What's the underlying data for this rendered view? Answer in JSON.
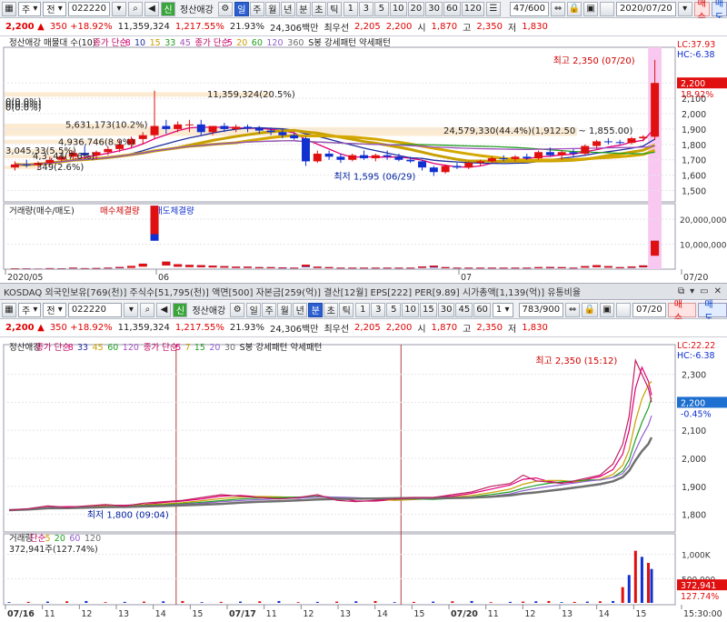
{
  "top": {
    "toolbar": {
      "code": "022220",
      "type1": "주",
      "type2": "전",
      "name": "정산애강",
      "periods": [
        "일",
        "주",
        "월",
        "년",
        "분",
        "초",
        "틱"
      ],
      "active_period": 0,
      "numbers": [
        "1",
        "3",
        "5",
        "10",
        "20",
        "30",
        "60",
        "120"
      ],
      "counter": "47",
      "counter_total": "/600",
      "date": "2020/07/20",
      "buy": "매수",
      "sell": "매도"
    },
    "quote": {
      "price": "2,200 ▲",
      "change": "350 +18.92%",
      "volume": "11,359,324",
      "rate": "1,217.55%",
      "turnover": "21.93%",
      "amount": "24,306백만",
      "best_label": "최우선",
      "ask": "2,205",
      "bid": "2,200",
      "open_label": "시",
      "open": "1,870",
      "high_label": "고",
      "high": "2,350",
      "low_label": "저",
      "low": "1,830"
    }
  },
  "status_bar": "KOSDAQ 외국인보유[769(천)] 주식수[51,795(천)] 액면[500] 자본금[259(억)] 결산[12월] EPS[222] PER[9.89] 시가총액[1,139(억)] 유통비율",
  "bottom": {
    "toolbar": {
      "code": "022220",
      "type1": "주",
      "type2": "전",
      "name": "정산애강",
      "periods": [
        "일",
        "주",
        "월",
        "년",
        "분",
        "초",
        "틱"
      ],
      "active_period": 4,
      "numbers": [
        "1",
        "3",
        "5",
        "10",
        "15",
        "30",
        "45",
        "60"
      ],
      "interval": "1",
      "counter": "783",
      "counter_total": "/900",
      "date": "07/20",
      "buy": "매수",
      "sell": "매도"
    },
    "quote": {
      "price": "2,200 ▲",
      "change": "350 +18.92%",
      "volume": "11,359,324",
      "rate": "1,217.55%",
      "turnover": "21.93%",
      "amount": "24,306백만",
      "best_label": "최우선",
      "ask": "2,205",
      "bid": "2,200",
      "open_label": "시",
      "open": "1,870",
      "high_label": "고",
      "high": "2,350",
      "low_label": "저",
      "low": "1,830"
    }
  },
  "chart_data": [
    {
      "type": "candlestick",
      "title": "정산애강 매물대 수(10)",
      "ma_label": "종가 단순",
      "ma_periods": [
        "8",
        "10",
        "15",
        "33",
        "45"
      ],
      "ma2_periods": [
        "5",
        "20",
        "60",
        "120",
        "360"
      ],
      "ma_colors": [
        "#e0007a",
        "#2030a0",
        "#c8a000",
        "#20a020",
        "#a050c0"
      ],
      "ma2_colors": [
        "#e0007a",
        "#c8a000",
        "#20a020",
        "#9060d0",
        "#707070"
      ],
      "extra_label": "S봉 강세패턴  약세패턴",
      "lc": "LC:37.93",
      "hc": "HC:-6.38",
      "yticks": [
        1500,
        1600,
        1700,
        1800,
        1900,
        2000,
        2100,
        2200
      ],
      "ytick_labels": [
        "1,500",
        "1,600",
        "1,700",
        "1,800",
        "1,900",
        "2,000",
        "2,100",
        "2,200"
      ],
      "ylim": [
        1450,
        2420
      ],
      "current_price": "2,200",
      "current_pct": "18.92%",
      "high_annotation": "최고 2,350 (07/20)",
      "low_annotation": "최저 1,595 (06/29)",
      "volume_profile": [
        {
          "label": "11,359,324(20.5%)"
        },
        {
          "label": "0(0.0%)"
        },
        {
          "label": "0(0.0%)"
        },
        {
          "label": "0(0.0%)"
        },
        {
          "label": "5,631,173(10.2%)"
        },
        {
          "label": "24,579,330(44.4%)(1,912.50 ~ 1,855.00)"
        },
        {
          "label": "4,936,746(8.9%)"
        },
        {
          "label": "3,045,33(5.5%)"
        },
        {
          "label": "4,3 ,44(7.6%)"
        },
        {
          "label": "349(2.6%)"
        }
      ],
      "xlabels": [
        "2020/05",
        "06",
        "07",
        "07/20"
      ],
      "candles": [
        [
          1650,
          1690,
          1630,
          1670
        ],
        [
          1670,
          1700,
          1650,
          1665
        ],
        [
          1665,
          1690,
          1640,
          1680
        ],
        [
          1680,
          1720,
          1660,
          1700
        ],
        [
          1700,
          1730,
          1690,
          1720
        ],
        [
          1720,
          1760,
          1700,
          1745
        ],
        [
          1745,
          1790,
          1720,
          1730
        ],
        [
          1730,
          1760,
          1700,
          1750
        ],
        [
          1750,
          1790,
          1730,
          1770
        ],
        [
          1770,
          1830,
          1750,
          1800
        ],
        [
          1800,
          1850,
          1780,
          1835
        ],
        [
          1835,
          1880,
          1800,
          1860
        ],
        [
          1860,
          2150,
          1840,
          1920
        ],
        [
          1920,
          1960,
          1870,
          1900
        ],
        [
          1900,
          1950,
          1880,
          1930
        ],
        [
          1930,
          1960,
          1880,
          1930
        ],
        [
          1930,
          1960,
          1860,
          1880
        ],
        [
          1880,
          1920,
          1860,
          1920
        ],
        [
          1920,
          1940,
          1880,
          1900
        ],
        [
          1900,
          1930,
          1880,
          1915
        ],
        [
          1915,
          1930,
          1880,
          1905
        ],
        [
          1905,
          1920,
          1870,
          1890
        ],
        [
          1890,
          1910,
          1860,
          1880
        ],
        [
          1880,
          1900,
          1840,
          1860
        ],
        [
          1860,
          1880,
          1830,
          1840
        ],
        [
          1840,
          1850,
          1660,
          1690
        ],
        [
          1690,
          1760,
          1680,
          1740
        ],
        [
          1740,
          1760,
          1700,
          1720
        ],
        [
          1720,
          1740,
          1680,
          1700
        ],
        [
          1700,
          1740,
          1690,
          1730
        ],
        [
          1730,
          1760,
          1700,
          1710
        ],
        [
          1710,
          1740,
          1690,
          1730
        ],
        [
          1730,
          1760,
          1700,
          1720
        ],
        [
          1720,
          1740,
          1690,
          1700
        ],
        [
          1700,
          1720,
          1680,
          1690
        ],
        [
          1690,
          1700,
          1630,
          1650
        ],
        [
          1650,
          1660,
          1595,
          1620
        ],
        [
          1620,
          1670,
          1610,
          1660
        ],
        [
          1660,
          1680,
          1640,
          1650
        ],
        [
          1650,
          1690,
          1640,
          1680
        ],
        [
          1680,
          1700,
          1660,
          1690
        ],
        [
          1690,
          1720,
          1680,
          1710
        ],
        [
          1710,
          1730,
          1690,
          1705
        ],
        [
          1705,
          1730,
          1690,
          1720
        ],
        [
          1720,
          1740,
          1700,
          1710
        ],
        [
          1710,
          1760,
          1700,
          1750
        ],
        [
          1750,
          1780,
          1720,
          1730
        ],
        [
          1730,
          1760,
          1700,
          1750
        ],
        [
          1750,
          1770,
          1720,
          1740
        ],
        [
          1740,
          1800,
          1730,
          1790
        ],
        [
          1790,
          1830,
          1770,
          1820
        ],
        [
          1820,
          1840,
          1800,
          1815
        ],
        [
          1815,
          1830,
          1800,
          1810
        ],
        [
          1810,
          1850,
          1800,
          1840
        ],
        [
          1840,
          1860,
          1820,
          1850
        ],
        [
          1850,
          2350,
          1830,
          2200
        ]
      ],
      "volume_ylim": [
        0,
        24000000
      ],
      "volume_yticks": [
        "20,000,000",
        "10,000,000"
      ],
      "volume_title": "거래량(매수/매도)",
      "volume_legend_buy": "매수체결량",
      "volume_legend_sell": "매도체결량",
      "volumes": [
        [
          200000,
          150000
        ],
        [
          150000,
          120000
        ],
        [
          100000,
          100000
        ],
        [
          200000,
          200000
        ],
        [
          150000,
          150000
        ],
        [
          300000,
          300000
        ],
        [
          200000,
          200000
        ],
        [
          250000,
          200000
        ],
        [
          300000,
          300000
        ],
        [
          400000,
          500000
        ],
        [
          800000,
          500000
        ],
        [
          1200000,
          1000000
        ],
        [
          11359324,
          14000000
        ],
        [
          1500000,
          1500000
        ],
        [
          1000000,
          1000000
        ],
        [
          900000,
          800000
        ],
        [
          800000,
          800000
        ],
        [
          700000,
          700000
        ],
        [
          600000,
          600000
        ],
        [
          500000,
          500000
        ],
        [
          500000,
          500000
        ],
        [
          400000,
          400000
        ],
        [
          400000,
          400000
        ],
        [
          300000,
          400000
        ],
        [
          300000,
          300000
        ],
        [
          800000,
          1000000
        ],
        [
          500000,
          500000
        ],
        [
          400000,
          400000
        ],
        [
          300000,
          300000
        ],
        [
          300000,
          300000
        ],
        [
          300000,
          300000
        ],
        [
          300000,
          300000
        ],
        [
          300000,
          300000
        ],
        [
          300000,
          300000
        ],
        [
          300000,
          300000
        ],
        [
          500000,
          600000
        ],
        [
          600000,
          800000
        ],
        [
          400000,
          400000
        ],
        [
          300000,
          300000
        ],
        [
          300000,
          300000
        ],
        [
          300000,
          300000
        ],
        [
          300000,
          300000
        ],
        [
          300000,
          300000
        ],
        [
          300000,
          300000
        ],
        [
          300000,
          300000
        ],
        [
          400000,
          400000
        ],
        [
          400000,
          500000
        ],
        [
          400000,
          400000
        ],
        [
          300000,
          300000
        ],
        [
          600000,
          600000
        ],
        [
          800000,
          800000
        ],
        [
          600000,
          600000
        ],
        [
          400000,
          400000
        ],
        [
          500000,
          600000
        ],
        [
          700000,
          800000
        ],
        [
          6000000,
          5359324
        ]
      ]
    },
    {
      "type": "line",
      "title": "정산애강",
      "ma_label": "종가 단순",
      "ma_periods": [
        "8",
        "33",
        "45",
        "60",
        "120"
      ],
      "ma2_periods": [
        "5",
        "7",
        "15",
        "20",
        "30"
      ],
      "ma_colors": [
        "#e0007a",
        "#2030a0",
        "#c8a000",
        "#20a020",
        "#a050c0"
      ],
      "ma2_colors": [
        "#e0007a",
        "#c8a000",
        "#20a020",
        "#9060d0",
        "#707070"
      ],
      "extra_label": "S봉 강세패턴  약세패턴",
      "lc": "LC:22.22",
      "hc": "HC:-6.38",
      "yticks": [
        1800,
        1900,
        2000,
        2100,
        2200,
        2300
      ],
      "ytick_labels": [
        "1,800",
        "1,900",
        "2,000",
        "2,100",
        "2,200",
        "2,300"
      ],
      "ylim": [
        1750,
        2380
      ],
      "current_price": "2,200",
      "current_pct": "-0.45%",
      "high_annotation": "최고 2,350 (15:12)",
      "low_annotation": "최저 1,800 (09:04)",
      "x": [
        0,
        0.03,
        0.06,
        0.09,
        0.12,
        0.15,
        0.18,
        0.21,
        0.24,
        0.27,
        0.3,
        0.33,
        0.36,
        0.39,
        0.42,
        0.45,
        0.48,
        0.51,
        0.54,
        0.57,
        0.6,
        0.63,
        0.66,
        0.69,
        0.72,
        0.75,
        0.78,
        0.8,
        0.82,
        0.84,
        0.86,
        0.88,
        0.9,
        0.92,
        0.94,
        0.955,
        0.965,
        0.975,
        0.985,
        0.995,
        1.0
      ],
      "price": [
        1815,
        1820,
        1830,
        1825,
        1830,
        1835,
        1830,
        1840,
        1845,
        1850,
        1860,
        1870,
        1865,
        1860,
        1855,
        1860,
        1870,
        1850,
        1845,
        1850,
        1855,
        1860,
        1860,
        1870,
        1880,
        1900,
        1910,
        1940,
        1920,
        1915,
        1910,
        1920,
        1930,
        1940,
        1980,
        2050,
        2150,
        2350,
        2300,
        2250,
        2200
      ],
      "xlabels": [
        "07/16",
        "11",
        "12",
        "13",
        "14",
        "15",
        "07/17",
        "11",
        "12",
        "13",
        "14",
        "15",
        "07/20",
        "11",
        "12",
        "13",
        "14",
        "15",
        "15:30:00"
      ],
      "volume_title": "거래량",
      "volume_ma_label": "단순",
      "volume_ma_periods": [
        "5",
        "20",
        "60",
        "120"
      ],
      "volume_current": "372,941주(127.74%)",
      "volume_yticks": [
        "1,000K",
        "500,000"
      ],
      "volume_ylim": [
        0,
        1200000
      ],
      "volume_current_value": "372,941",
      "volume_current_pct": "127.74%"
    }
  ]
}
